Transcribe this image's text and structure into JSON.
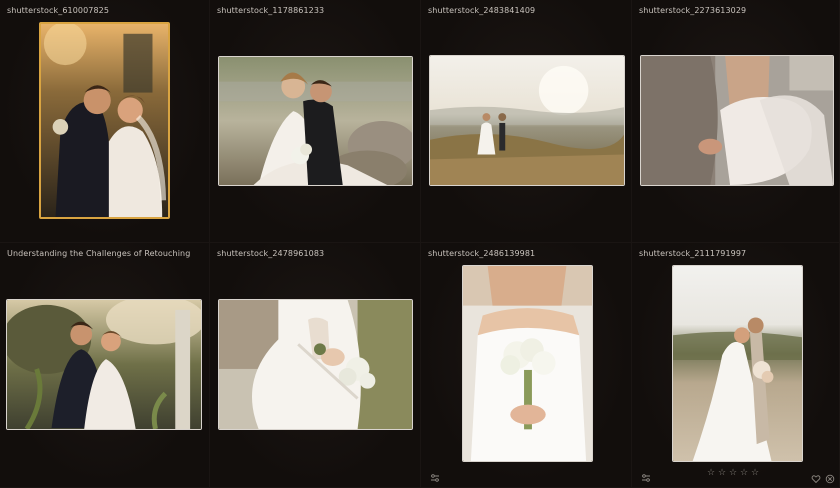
{
  "photos": [
    {
      "title": "shutterstock_610007825"
    },
    {
      "title": "shutterstock_1178861233"
    },
    {
      "title": "shutterstock_2483841409"
    },
    {
      "title": "shutterstock_2273613029"
    },
    {
      "title": "Understanding the Challenges of Retouching"
    },
    {
      "title": "shutterstock_2478961083"
    },
    {
      "title": "shutterstock_2486139981"
    },
    {
      "title": "shutterstock_2111791997"
    }
  ],
  "icons": {
    "adjust": "sliders-icon",
    "star": "star-icon",
    "heart": "heart-icon",
    "reject": "reject-icon"
  },
  "rating": {
    "max": 5,
    "value": 0
  },
  "star_glyph": "☆",
  "colors": {
    "selection": "#d9a441",
    "background": "#100c0a"
  }
}
